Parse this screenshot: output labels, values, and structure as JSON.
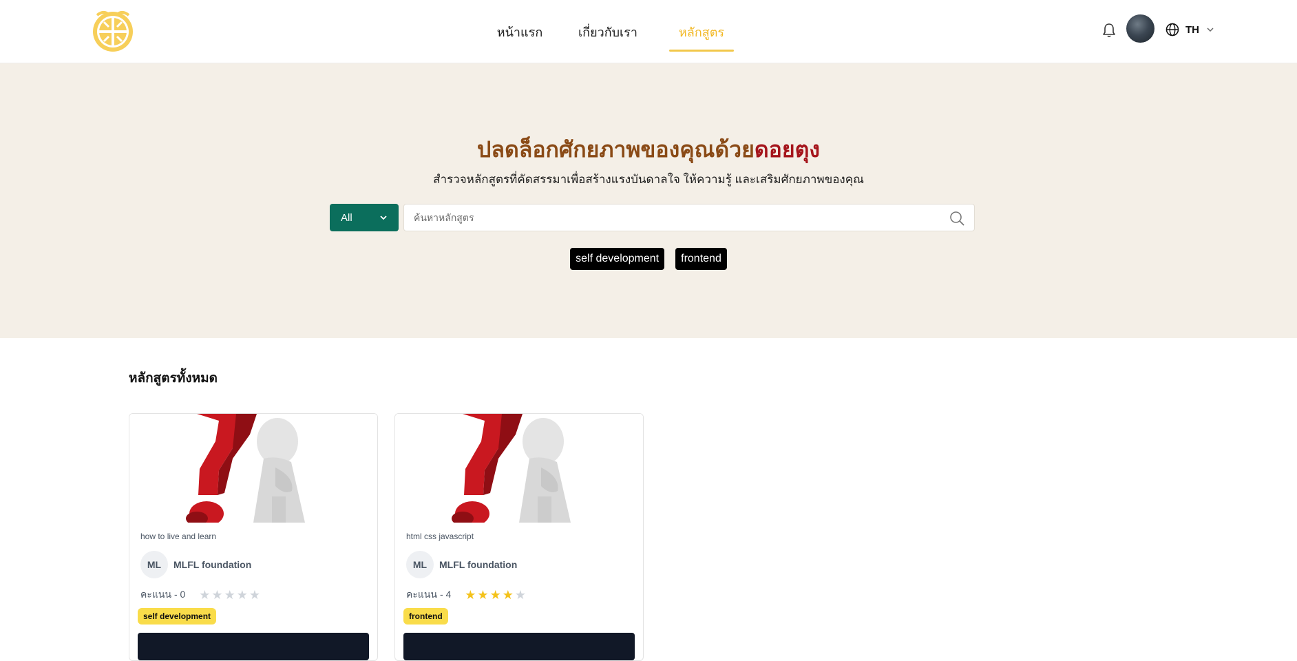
{
  "header": {
    "nav": [
      {
        "label": "หน้าแรก"
      },
      {
        "label": "เกี่ยวกับเรา"
      },
      {
        "label": "หลักสูตร"
      }
    ],
    "language": "TH"
  },
  "hero": {
    "title_prefix": "ปลดล็อกศักยภาพของคุณด้วย",
    "title_brand": "ดอยตุง",
    "subtitle": "สำรวจหลักสูตรที่คัดสรรมาเพื่อสร้างแรงบันดาลใจ ให้ความรู้ และเสริมศักยภาพของคุณ",
    "category_selected": "All",
    "search_placeholder": "ค้นหาหลักสูตร",
    "tags": [
      "self development",
      "frontend"
    ]
  },
  "courses": {
    "section_title": "หลักสูตรทั้งหมด",
    "items": [
      {
        "title": "how to live and learn",
        "org_initials": "ML",
        "org_name": "MLFL foundation",
        "rating_label": "คะแนน - 0",
        "rating": 0,
        "category": "self development"
      },
      {
        "title": "html css javascript",
        "org_initials": "ML",
        "org_name": "MLFL foundation",
        "rating_label": "คะแนน - 4",
        "rating": 4,
        "category": "frontend"
      }
    ]
  },
  "colors": {
    "accent_gold": "#f2b824",
    "hero_bg": "#f4efe7",
    "title_brown": "#8a4a16",
    "brand_red": "#a5151c",
    "select_green": "#0b6e5c",
    "category_yellow": "#f9dc4a"
  }
}
